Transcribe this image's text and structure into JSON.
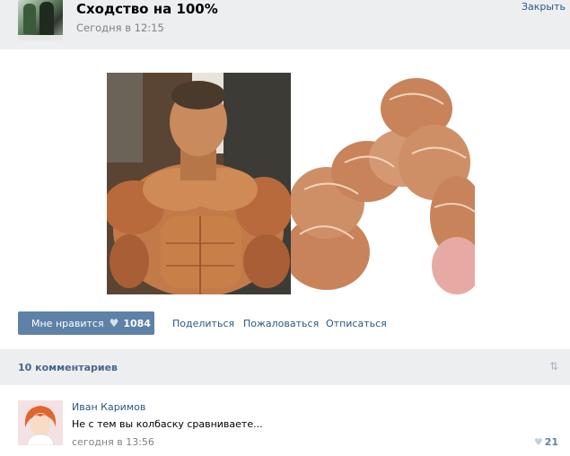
{
  "post": {
    "title": "Сходство на 100%",
    "time": "Сегодня в 12:15",
    "close_label": "Закрыть"
  },
  "actions": {
    "like_label": "Мне нравится",
    "like_count": "1084",
    "share": "Поделиться",
    "report": "Пожаловаться",
    "unsubscribe": "Отписаться"
  },
  "comments": {
    "count_label": "10 комментариев",
    "items": [
      {
        "author": "Иван Каримов",
        "text": "Не с тем вы колбаску сравниваете...",
        "time": "сегодня в 13:56",
        "likes": "21"
      }
    ]
  },
  "colors": {
    "link": "#2a5885",
    "button": "#5e81a8",
    "panel": "#edeef0"
  }
}
